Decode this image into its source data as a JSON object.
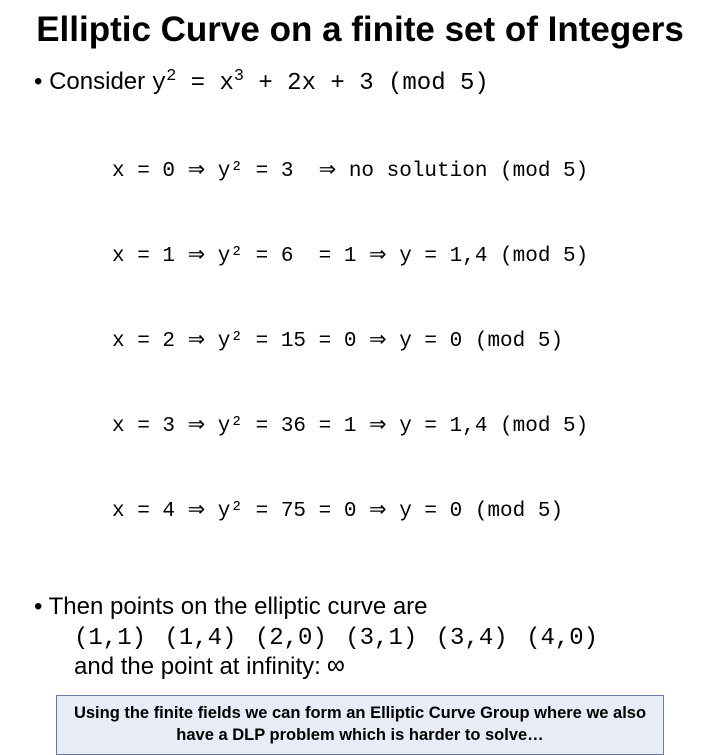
{
  "title": "Elliptic Curve on a finite set of Integers",
  "consider": {
    "prefix": "Consider ",
    "eq_a": "y",
    "eq_sup1": "2",
    "eq_b": " = x",
    "eq_sup2": "3",
    "eq_c": " + 2x + 3 (mod 5)"
  },
  "rows": [
    "x = 0 ⇒ y² = 3  ⇒ no solution (mod 5)",
    "x = 1 ⇒ y² = 6  = 1 ⇒ y = 1,4 (mod 5)",
    "x = 2 ⇒ y² = 15 = 0 ⇒ y = 0 (mod 5)",
    "x = 3 ⇒ y² = 36 = 1 ⇒ y = 1,4 (mod 5)",
    "x = 4 ⇒ y² = 75 = 0 ⇒ y = 0 (mod 5)"
  ],
  "then_text": "Then points on the elliptic curve are",
  "points_list": "(1,1) (1,4) (2,0) (3,1) (3,4) (4,0)",
  "points_tail_a": "and the point at infinity: ",
  "points_tail_inf": "∞",
  "footer": "Using the finite fields we can form an Elliptic Curve Group where we also have a DLP problem which is harder to solve…"
}
